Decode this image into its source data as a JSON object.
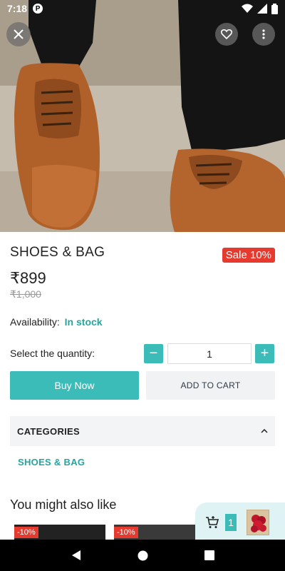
{
  "status_bar": {
    "time": "7:18",
    "app_icon_letter": "P",
    "icons": [
      "wifi-icon",
      "signal-icon",
      "battery-icon"
    ]
  },
  "hero": {
    "buttons": [
      "close-icon",
      "heart-icon",
      "more-vert-icon"
    ]
  },
  "product": {
    "title": "SHOES & BAG",
    "sale_badge": "Sale 10%",
    "price": "₹899",
    "old_price": "₹1,000",
    "availability_label": "Availability:",
    "availability_value": "In stock"
  },
  "quantity": {
    "label": "Select the quantity:",
    "value": "1",
    "minus": "−",
    "plus": "+"
  },
  "actions": {
    "buy_now": "Buy Now",
    "add_to_cart": "ADD TO CART"
  },
  "categories": {
    "header": "CATEGORIES",
    "items": [
      "SHOES & BAG"
    ]
  },
  "recommendations": {
    "title": "You might also like",
    "cards": [
      {
        "discount": "-10%"
      },
      {
        "discount": "-10%"
      }
    ]
  },
  "cart": {
    "count": "1"
  },
  "colors": {
    "accent": "#3cbcb8",
    "sale": "#e63a2e",
    "stock": "#23a6a0"
  }
}
